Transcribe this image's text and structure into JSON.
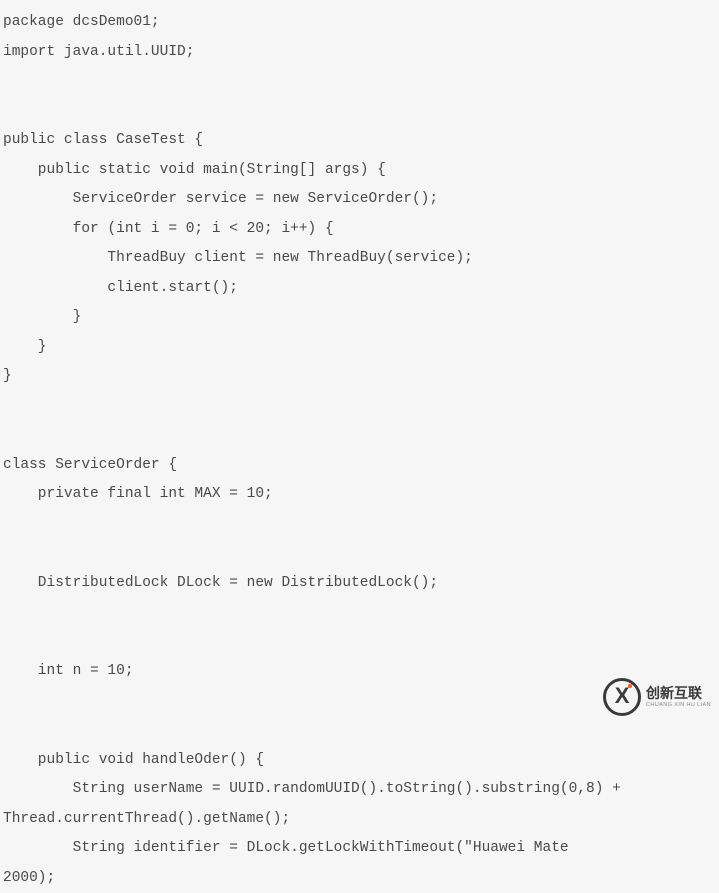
{
  "code": {
    "lines": [
      "package dcsDemo01;",
      "import java.util.UUID;",
      "",
      "",
      "public class CaseTest {",
      "    public static void main(String[] args) {",
      "        ServiceOrder service = new ServiceOrder();",
      "        for (int i = 0; i < 20; i++) {",
      "            ThreadBuy client = new ThreadBuy(service);",
      "            client.start();",
      "        }",
      "    }",
      "}",
      "",
      "",
      "class ServiceOrder {",
      "    private final int MAX = 10;",
      "",
      "",
      "    DistributedLock DLock = new DistributedLock();",
      "",
      "",
      "    int n = 10;",
      "",
      "",
      "    public void handleOder() {",
      "        String userName = UUID.randomUUID().toString().substring(0,8) + ",
      "Thread.currentThread().getName();",
      "        String identifier = DLock.getLockWithTimeout(\"Huawei Mate ",
      "2000);"
    ]
  },
  "watermark": {
    "logo_letter": "X",
    "cn": "创新互联",
    "en": "CHUANG XIN HU LIAN"
  }
}
